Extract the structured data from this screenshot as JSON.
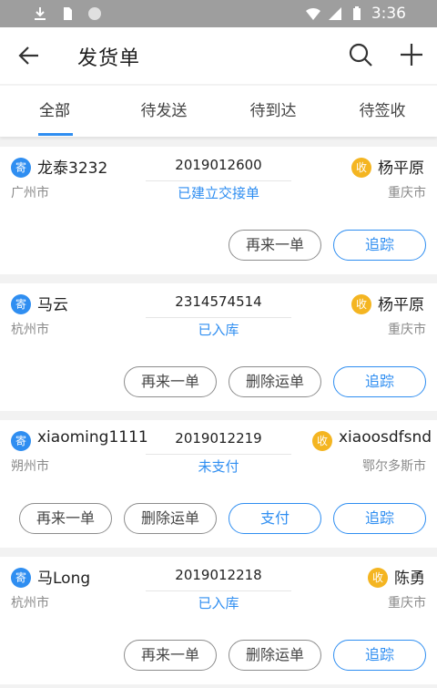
{
  "statusbar": {
    "time": "3:36"
  },
  "appbar": {
    "title": "发货单"
  },
  "tabs": [
    {
      "label": "全部"
    },
    {
      "label": "待发送"
    },
    {
      "label": "待到达"
    },
    {
      "label": "待签收"
    }
  ],
  "labels": {
    "sender_badge": "寄",
    "receiver_badge": "收"
  },
  "orders": [
    {
      "sender": "龙泰3232",
      "order_no": "2019012600",
      "receiver": "杨平原",
      "from_city": "广州市",
      "status": "已建立交接单",
      "to_city": "重庆市",
      "buttons": [
        "再来一单",
        "追踪"
      ]
    },
    {
      "sender": "马云",
      "order_no": "2314574514",
      "receiver": "杨平原",
      "from_city": "杭州市",
      "status": "已入库",
      "to_city": "重庆市",
      "buttons": [
        "再来一单",
        "删除运单",
        "追踪"
      ]
    },
    {
      "sender": "xiaoming1111",
      "order_no": "2019012219",
      "receiver": "xiaoosdfsnd",
      "from_city": "朔州市",
      "status": "未支付",
      "to_city": "鄂尔多斯市",
      "buttons": [
        "再来一单",
        "删除运单",
        "支付",
        "追踪"
      ]
    },
    {
      "sender": "马Long",
      "order_no": "2019012218",
      "receiver": "陈勇",
      "from_city": "杭州市",
      "status": "已入库",
      "to_city": "重庆市",
      "buttons": [
        "再来一单",
        "删除运单",
        "追踪"
      ]
    }
  ],
  "colors": {
    "accent": "#2f8ef1",
    "receiver_badge": "#f4b521",
    "status_bar": "#9e9e9e"
  }
}
